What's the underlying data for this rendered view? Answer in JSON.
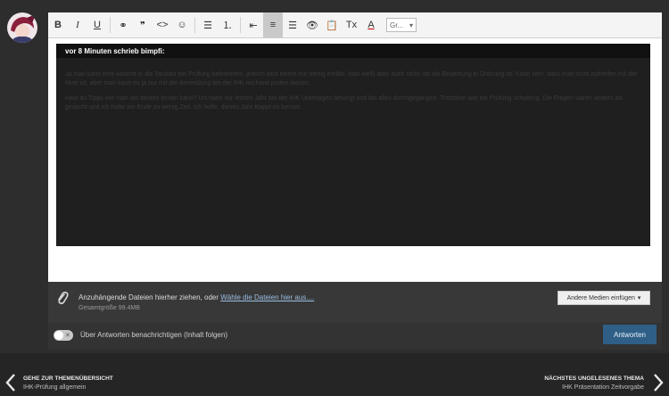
{
  "toolbar": {
    "buttons": [
      {
        "name": "bold-button",
        "glyph": "B"
      },
      {
        "name": "italic-button",
        "glyph": "I"
      },
      {
        "name": "underline-button",
        "glyph": "U"
      },
      {
        "name": "link-button",
        "glyph": "⚭"
      },
      {
        "name": "quote-button",
        "glyph": "❞"
      },
      {
        "name": "code-button",
        "glyph": "<>"
      },
      {
        "name": "emoji-button",
        "glyph": "☺"
      },
      {
        "name": "bullet-list-button",
        "glyph": "☰"
      },
      {
        "name": "numbered-list-button",
        "glyph": "⒈"
      },
      {
        "name": "outdent-button",
        "glyph": "⇤"
      },
      {
        "name": "align-left-button",
        "glyph": "≡"
      },
      {
        "name": "align-center-button",
        "glyph": "☰"
      },
      {
        "name": "preview-button",
        "glyph": "👁"
      },
      {
        "name": "paste-button",
        "glyph": "📋"
      },
      {
        "name": "clear-format-button",
        "glyph": "Tx"
      },
      {
        "name": "text-color-button",
        "glyph": "A"
      }
    ],
    "font_size_value": "Gr..."
  },
  "quote": {
    "header": "vor 8 Minuten schrieb bimpfi:",
    "paragraph1": "Ja man kann eine Ansicht in die Struktur bei Prüfung bekommen, jedoch wird einem nur wenig erklärt. Man weiß aber auch nicht, ob die Bewertung in Ordnung ist. Kann sein, dass man nicht zufrieden mit der Note ist, aber man kann es ja nur mit der Anmeldung bei der IHK nochmal prüfen lassen.",
    "paragraph2": "Hast du Tipps wie man am besten lernen kann? Ich habe mir letztes Jahr bei der IHK Unterlagen besorgt und bin alles durchgegangen. Trotzdem war die Prüfung schwierig. Die Fragen waren anders als gedacht und ich hatte am Ende zu wenig Zeit. Ich hoffe, dieses Jahr klappt es besser."
  },
  "attach": {
    "drag_text": "Anzuhängende Dateien hierher ziehen, oder ",
    "choose_link": "Wähle die Dateien hier aus....",
    "total_size": "Gesamtgröße 99.4MB",
    "media_button": "Andere Medien einfügen"
  },
  "notify": {
    "toggle_mark": "✕",
    "label": "Über Antworten benachrichtigen (Inhalt folgen)"
  },
  "reply_button": "Antworten",
  "nav": {
    "prev_title": "GEHE ZUR THEMENÜBERSICHT",
    "prev_sub": "IHK-Prüfung allgemein",
    "next_title": "NÄCHSTES UNGELESENES THEMA",
    "next_sub": "IHK Präsentation Zeitvorgabe"
  },
  "colors": {
    "reply_button": "#2f5f86",
    "link": "#9bbfe3"
  }
}
